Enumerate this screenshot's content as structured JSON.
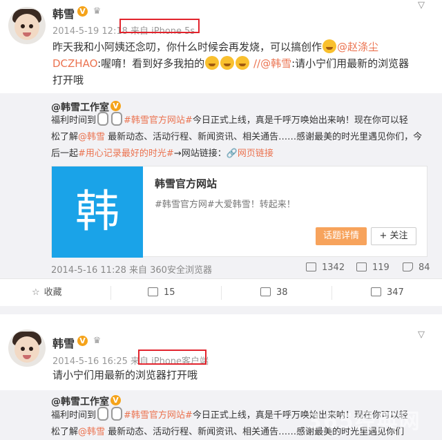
{
  "post1": {
    "username": "韩雪",
    "vip_badge": "V",
    "meta": "2014-5-19 12:18 来自 iPhone 5s",
    "body_parts": [
      "昨天我和小阿姨还念叨，你什么时候会再发烧，可以搞创作",
      "@赵涤尘DCZHAO",
      ":喔唷！看到好多我拍的",
      "//",
      "@韩雪",
      ":请小宁们用最新的浏览器打开哦"
    ]
  },
  "repost1": {
    "author": "@韩雪工作室",
    "line1_a": "福利时间到",
    "line1_hash": "#韩雪官方网站#",
    "line1_b": "今日正式上线，真是千呼万唤始出来呐！现在你可以轻",
    "line2_a": "松了解",
    "line2_mention": "@韩雪",
    "line2_b": " 最新动态、活动行程、新闻资讯、相关通告……感谢最美的时光里遇见你们，今",
    "line3_a": "后一起",
    "line3_hash": "#用心记录最好的时光#",
    "line3_b": "→网站链接：",
    "line3_link": "网页链接",
    "card_logo": "韩",
    "card_title": "韩雪官方网站",
    "card_desc": "#韩雪官方网#大爱韩雪！转起来！",
    "topic_button": "话题详情",
    "follow_button": "+ 关注",
    "meta": "2014-5-16 11:28 来自 360安全浏览器",
    "reposts": "1342",
    "comments": "119",
    "likes": "84"
  },
  "actions1": {
    "favorite": "收藏",
    "forward": "15",
    "comment": "38",
    "like": "347"
  },
  "post2": {
    "username": "韩雪",
    "vip_badge": "V",
    "meta": "2014-5-16 16:25 来自 iPhone客户端",
    "body": "请小宁们用最新的浏览器打开哦"
  },
  "repost2": {
    "author": "@韩雪工作室",
    "line1_a": "福利时间到",
    "line1_hash": "#韩雪官方网站#",
    "line1_b": "今日正式上线，真是千呼万唤始出来呐！现在你可以轻",
    "line2_a": "松了解",
    "line2_mention": "@韩雪",
    "line2_b": " 最新动态、活动行程、新闻资讯、相关通告……感谢最美的时光里遇见你们"
  },
  "watermark": "365经典网",
  "colors": {
    "link": "#eb7350",
    "highlight_box": "#e2232c",
    "vip": "#f5a31a",
    "card_blue": "#1aa3e8"
  }
}
